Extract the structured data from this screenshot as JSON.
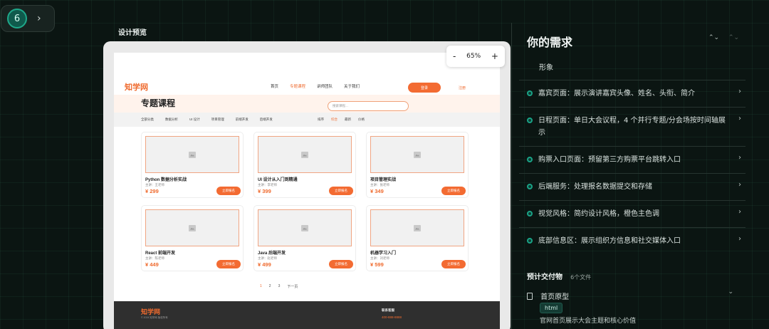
{
  "step": {
    "number": "6"
  },
  "preview": {
    "label": "设计预览",
    "zoom": {
      "minus": "-",
      "level": "65%",
      "plus": "+"
    },
    "site": {
      "logo": "知学网",
      "nav": [
        "首页",
        "专题课程",
        "讲师团队",
        "关于我们"
      ],
      "nav_active_index": 1,
      "login": "登录",
      "register": "注册",
      "hero_title": "专题课程",
      "search_placeholder": "搜索课程...",
      "categories": [
        "全部分类",
        "数据分析",
        "UI 设计",
        "项目管理",
        "前端开发",
        "后端开发"
      ],
      "sort": [
        "排序",
        "综合",
        "最新",
        "价格"
      ],
      "sort_active_index": 1,
      "courses": [
        {
          "title": "Python 数据分析实战",
          "instructor": "主讲：王老师",
          "price": "¥ 299",
          "button": "立即报名"
        },
        {
          "title": "UI 设计从入门到精通",
          "instructor": "主讲：李老师",
          "price": "¥ 399",
          "button": "立即报名"
        },
        {
          "title": "项目管理实战",
          "instructor": "主讲：张老师",
          "price": "¥ 349",
          "button": "立即报名"
        },
        {
          "title": "React 前端开发",
          "instructor": "主讲：陈老师",
          "price": "¥ 449",
          "button": "立即报名"
        },
        {
          "title": "Java 后端开发",
          "instructor": "主讲：赵老师",
          "price": "¥ 499",
          "button": "立即报名"
        },
        {
          "title": "机器学习入门",
          "instructor": "主讲：刘老师",
          "price": "¥ 599",
          "button": "立即报名"
        }
      ],
      "pagination": [
        "1",
        "2",
        "3",
        "下一页"
      ],
      "pagination_active_index": 0,
      "footer": {
        "logo": "知学网",
        "copyright": "© 2024 知学网 版权所有",
        "contact_heading": "联系客服",
        "phone": "400-888-8888"
      }
    }
  },
  "panel": {
    "title": "你的需求",
    "arrows": {
      "active": "⌃⌄",
      "dim": "⌃⌄"
    },
    "first_item": "形象",
    "requirements": [
      "嘉宾页面：展示演讲嘉宾头像、姓名、头衔、简介",
      "日程页面：单日大会议程，4 个并行专题/分会场按时间轴展示",
      "购票入口页面：预留第三方购票平台跳转入口",
      "后端服务：处理报名数据提交和存储",
      "视觉风格：简约设计风格，橙色主色调",
      "底部信息区：展示组织方信息和社交媒体入口"
    ],
    "deliverables": {
      "title": "预计交付物",
      "count": "6个文件",
      "items": [
        {
          "name": "首页原型",
          "tag": "html",
          "description": "官网首页展示大会主题和核心价值"
        }
      ]
    }
  },
  "colors": {
    "accent_orange": "#f36b32",
    "teal": "#1aa386",
    "background": "#0b1512"
  }
}
